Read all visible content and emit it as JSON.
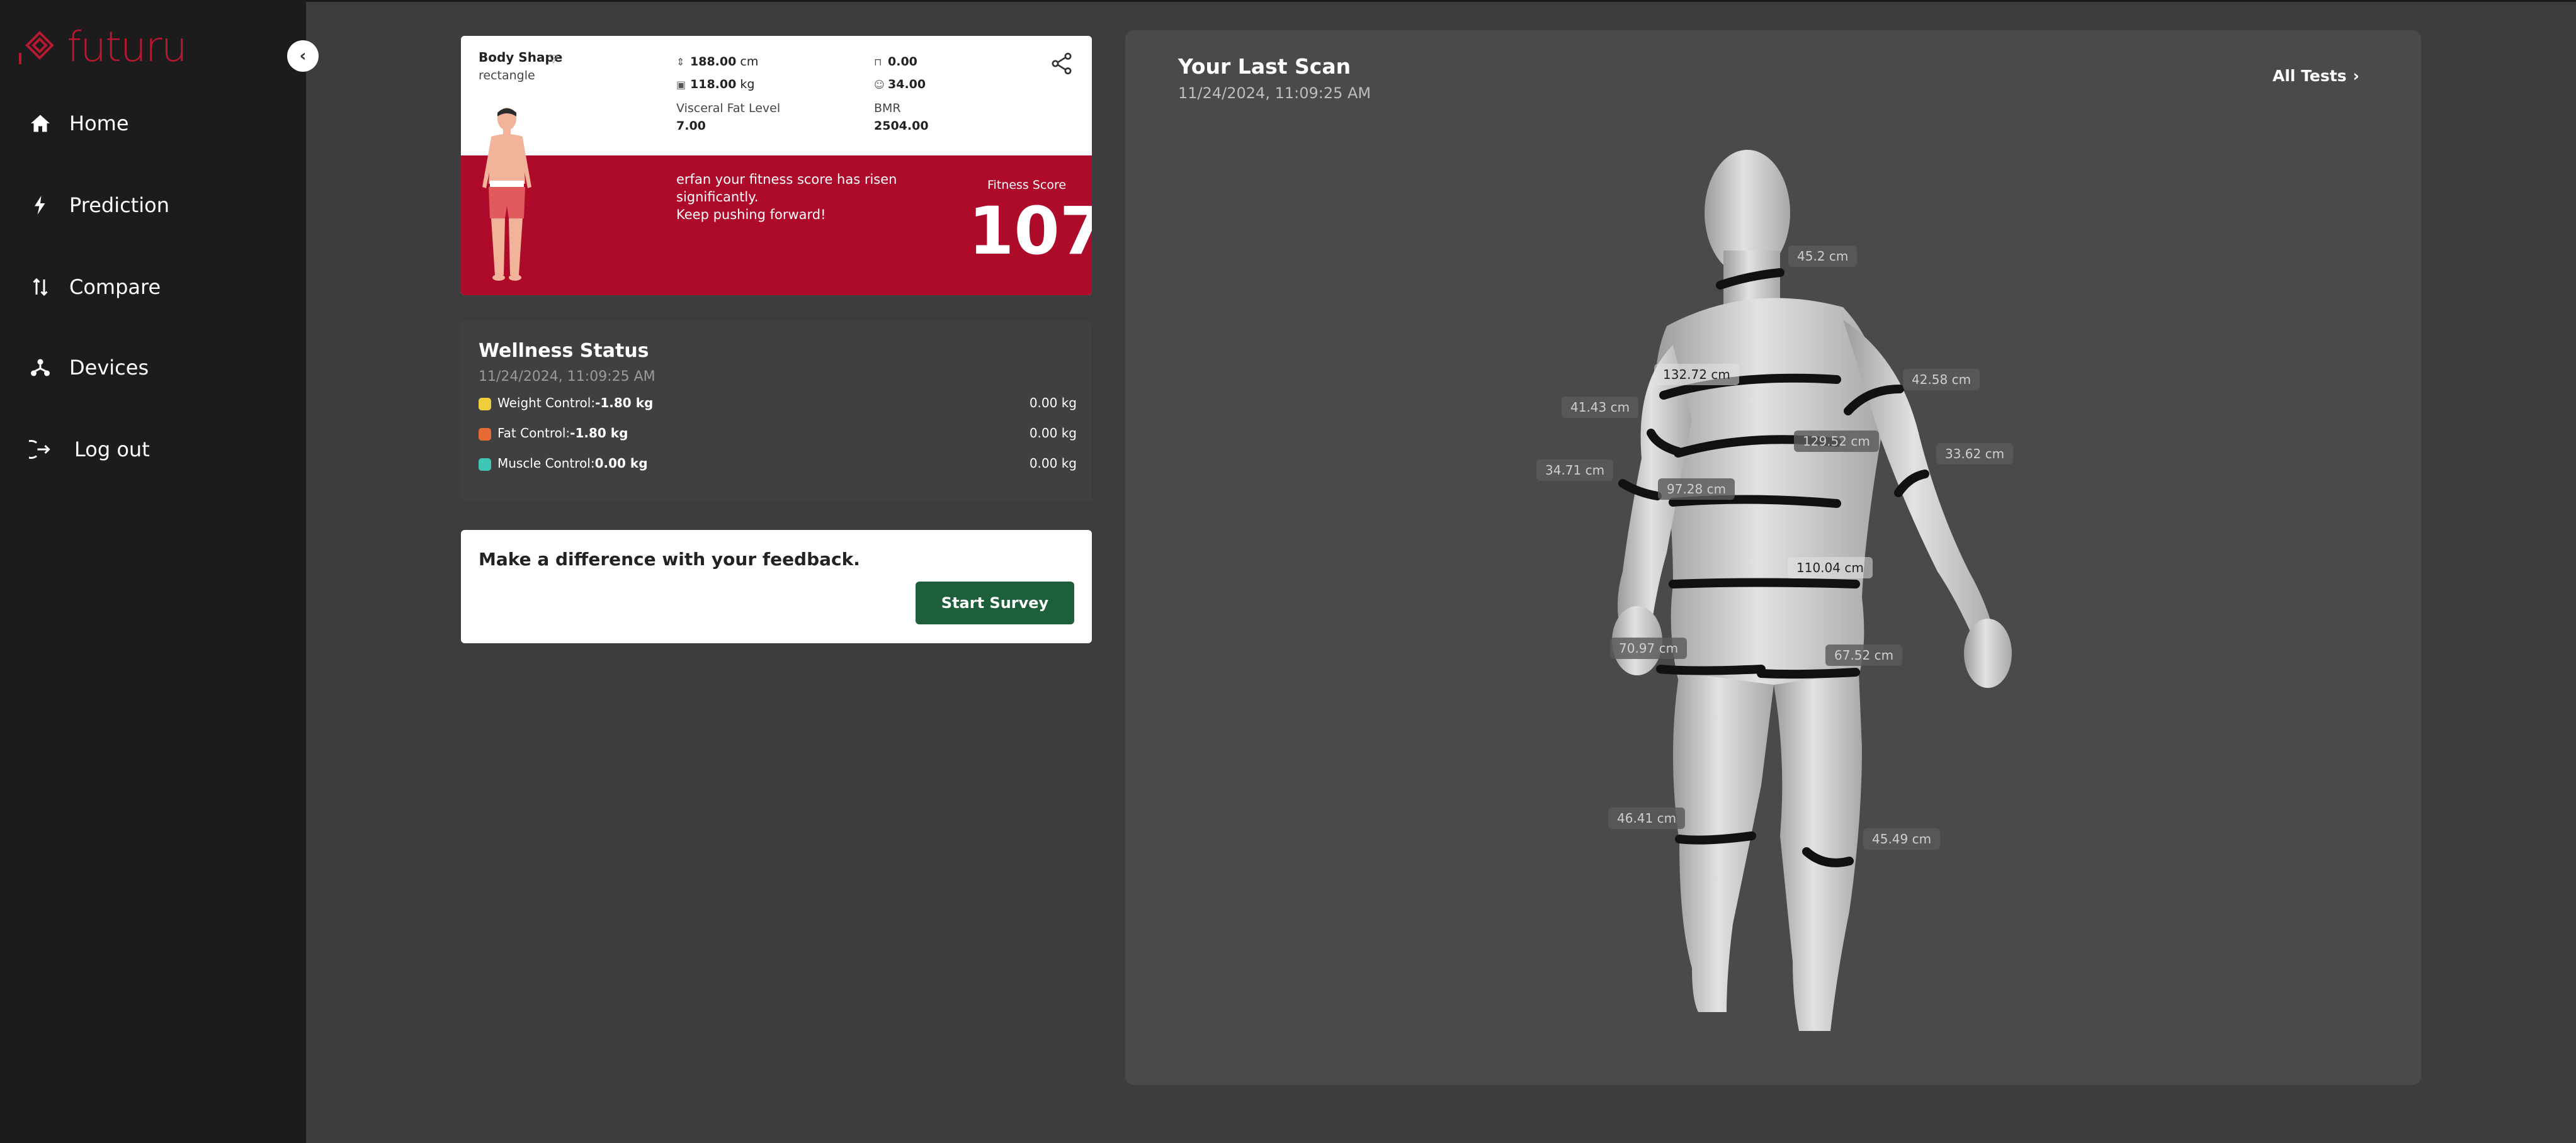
{
  "app": {
    "logo_text": "futuru"
  },
  "sidebar": {
    "items": [
      {
        "label": "Home",
        "icon": "home-icon"
      },
      {
        "label": "Prediction",
        "icon": "bolt-icon"
      },
      {
        "label": "Compare",
        "icon": "compare-arrows-icon"
      },
      {
        "label": "Devices",
        "icon": "devices-icon"
      },
      {
        "label": "Log out",
        "icon": "logout-icon"
      }
    ]
  },
  "profile": {
    "body_shape_label": "Body Shape",
    "body_shape_value": "rectangle",
    "height": "188.00",
    "height_unit": "cm",
    "weight": "118.00",
    "weight_unit": "kg",
    "metric_a": "0.00",
    "metric_b": "34.00",
    "visceral_label": "Visceral Fat Level",
    "visceral_value": "7.00",
    "bmr_label": "BMR",
    "bmr_value": "2504.00",
    "message_line1": "erfan your fitness score has risen significantly.",
    "message_line2": "Keep pushing forward!",
    "fitness_label": "Fitness Score",
    "fitness_score": "107"
  },
  "wellness": {
    "title": "Wellness Status",
    "date": "11/24/2024, 11:09:25 AM",
    "rows": [
      {
        "label": "Weight Control:",
        "value": "-1.80 kg",
        "right": "0.00 kg",
        "color": "#f0cd3a"
      },
      {
        "label": "Fat Control:",
        "value": "-1.80 kg",
        "right": "0.00 kg",
        "color": "#e86b35"
      },
      {
        "label": "Muscle Control:",
        "value": "0.00 kg",
        "right": "0.00 kg",
        "color": "#3fc7b5"
      }
    ]
  },
  "survey": {
    "text": "Make a difference with your feedback.",
    "button": "Start Survey"
  },
  "scan": {
    "title": "Your Last Scan",
    "date": "11/24/2024, 11:09:25 AM",
    "all_tests": "All Tests",
    "measurements": {
      "neck": "45.2 cm",
      "chest": "132.72 cm",
      "bicep_left": "42.58 cm",
      "bicep_right": "41.43 cm",
      "waist": "129.52 cm",
      "forearm_left": "33.62 cm",
      "forearm_right": "34.71 cm",
      "abdomen": "97.28 cm",
      "hip": "110.04 cm",
      "thigh_right": "70.97 cm",
      "thigh_left": "67.52 cm",
      "calf_right": "46.41 cm",
      "calf_left": "45.49 cm"
    }
  },
  "colors": {
    "brand_red": "#ae0a2a",
    "survey_green": "#1d5e3b",
    "sidebar_bg": "#1c1c1d"
  }
}
